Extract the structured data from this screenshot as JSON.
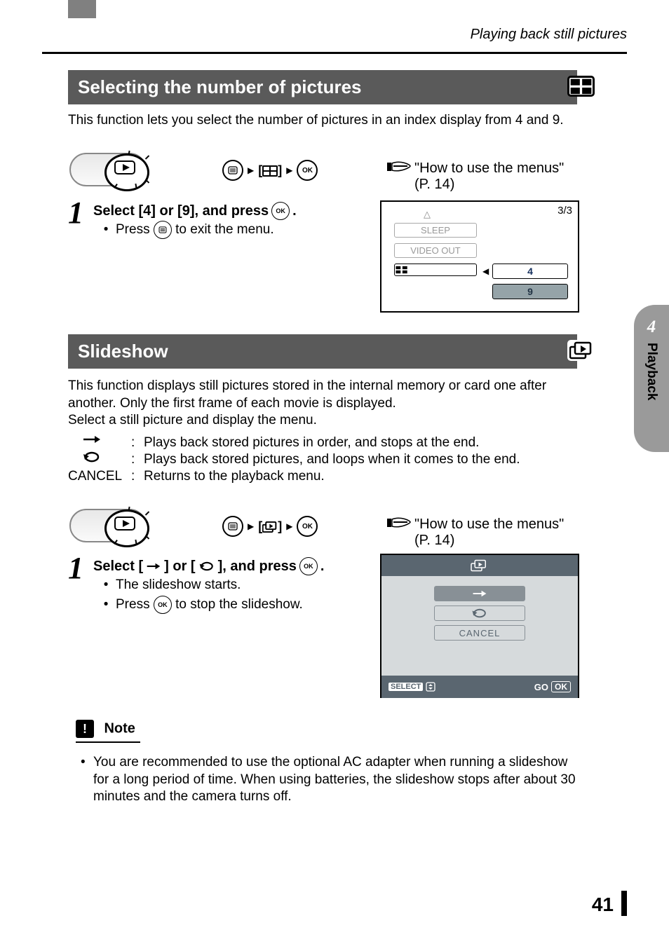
{
  "running_head": "Playing back still pictures",
  "section1": {
    "title": "Selecting the number of pictures",
    "intro": "This function lets you select the number of pictures in an index display from 4 and 9.",
    "ref": "\"How to use the menus\" (P. 14)",
    "step_num": "1",
    "step_title_pre": "Select [4] or [9], and press ",
    "step_title_post": ".",
    "bullet1_pre": "Press ",
    "bullet1_post": " to exit the menu.",
    "lcd_page": "3/3",
    "lcd_rows": {
      "sleep": "SLEEP",
      "video": "VIDEO OUT"
    },
    "lcd_vals": {
      "v1": "4",
      "v2": "9"
    }
  },
  "section2": {
    "title": "Slideshow",
    "intro": "This function displays still pictures stored in the internal memory or card one after another. Only the first frame of each movie is displayed.\nSelect a still picture and display the menu.",
    "opt1": "Plays back stored pictures in order, and stops at the end.",
    "opt2": "Plays back stored pictures, and loops when it comes to the end.",
    "opt_cancel_label": "CANCEL",
    "opt3": "Returns to the playback menu.",
    "ref": "\"How to use the menus\" (P. 14)",
    "step_num": "1",
    "step_title_pre": "Select [",
    "step_title_mid": "] or [",
    "step_title_post": "], and press ",
    "step_title_end": ".",
    "bullet1": "The slideshow starts.",
    "bullet2_pre": "Press ",
    "bullet2_post": " to stop the slideshow.",
    "lcd_cancel": "CANCEL",
    "lcd_select": "SELECT",
    "lcd_go": "GO"
  },
  "note": {
    "label": "Note",
    "text": "You are recommended to use the optional AC adapter when running a slideshow for a long period of time. When using batteries, the slideshow stops after about 30 minutes and the camera turns off."
  },
  "thumb": {
    "num": "4",
    "label": "Playback"
  },
  "page_number": "41",
  "menu_labels": {
    "bracket_open": "[",
    "bracket_close": "]",
    "ok": "OK"
  }
}
